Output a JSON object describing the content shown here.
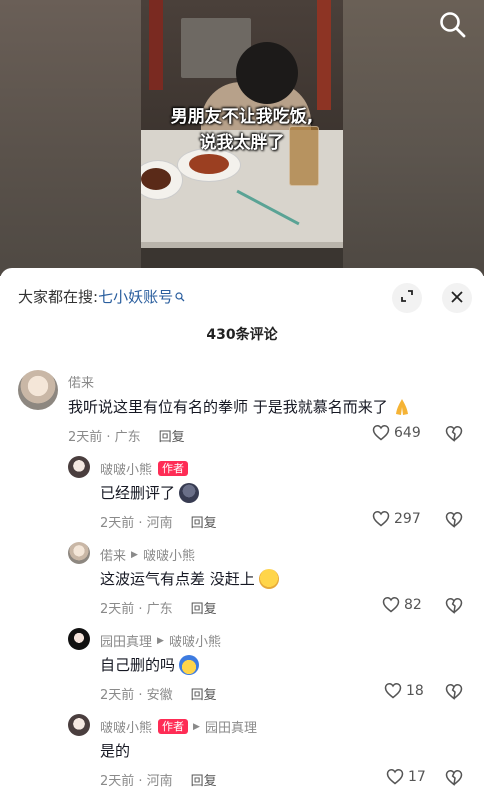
{
  "video": {
    "subtitle_line1": "男朋友不让我吃饭,",
    "subtitle_line2": "说我太胖了"
  },
  "sheet": {
    "search_prefix": "大家都在搜:",
    "search_keyword": "七小妖账号",
    "comment_count": "430条评论"
  },
  "comments": [
    {
      "author": "偌来",
      "text": "我听说这里有位有名的拳师 于是我就慕名而来了",
      "time": "2天前 · 广东",
      "reply": "回复",
      "likes": "649",
      "emoji": "pray-hands"
    },
    {
      "author": "啵啵小熊",
      "author_tag": "作者",
      "text": "已经删评了",
      "time": "2天前 · 河南",
      "reply": "回复",
      "likes": "297",
      "emoji": "dark-face"
    },
    {
      "author": "偌来",
      "reply_to": "啵啵小熊",
      "text": "这波运气有点差 没赶上",
      "time": "2天前 · 广东",
      "reply": "回复",
      "likes": "82",
      "emoji": "crying-face"
    },
    {
      "author": "园田真理",
      "reply_to": "啵啵小熊",
      "text": "自己删的吗",
      "time": "2天前 · 安徽",
      "reply": "回复",
      "likes": "18",
      "emoji": "hat-face"
    },
    {
      "author": "啵啵小熊",
      "author_tag": "作者",
      "reply_to": "园田真理",
      "text": "是的",
      "time": "2天前 · 河南",
      "reply": "回复",
      "likes": "17"
    }
  ],
  "colors": {
    "author_tag_bg": "#fe2c55",
    "keyword": "#2a5e9e",
    "meta": "#8a8a8a"
  }
}
